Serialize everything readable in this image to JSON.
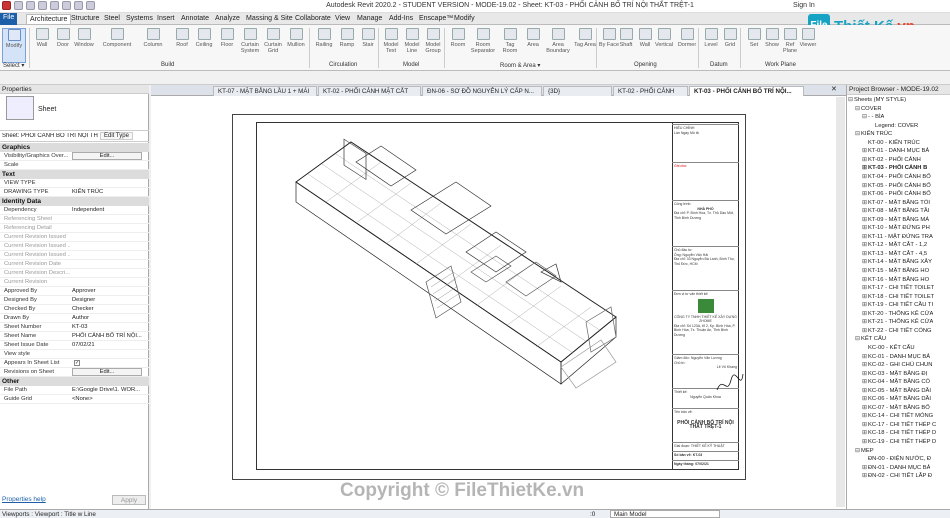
{
  "app": {
    "title": "Autodesk Revit 2020.2 - STUDENT VERSION - MODE-19.02 - Sheet: KT-03 - PHỐI CẢNH BỐ TRÍ NỘI THẤT TRỆT-1",
    "sign_in": "Sign In"
  },
  "logo": {
    "icon": "File",
    "main": "Thiết Kế",
    "dot": ".vn"
  },
  "ribbon_tabs": [
    "File",
    "Architecture",
    "Structure",
    "Steel",
    "Systems",
    "Insert",
    "Annotate",
    "Analyze",
    "Massing & Site",
    "Collaborate",
    "View",
    "Manage",
    "Add-Ins",
    "Enscape™",
    "Modify"
  ],
  "ribbon_tools": [
    "Modify",
    "Wall",
    "Door",
    "Window",
    "Component",
    "Column",
    "Roof",
    "Ceiling",
    "Floor",
    "Curtain System",
    "Curtain Grid",
    "Mullion",
    "Railing",
    "Ramp",
    "Stair",
    "Model Text",
    "Model Line",
    "Model Group",
    "Room",
    "Room Separator",
    "Tag Room",
    "Area",
    "Area Boundary",
    "Tag Area",
    "By Face",
    "Shaft",
    "Wall",
    "Vertical",
    "Dormer",
    "Level",
    "Grid",
    "Set",
    "Show",
    "Ref Plane",
    "Viewer"
  ],
  "ribbon_groups": {
    "select": "Select ▾",
    "build": "Build",
    "circulation": "Circulation",
    "model": "Model",
    "room_area": "Room & Area ▾",
    "opening": "Opening",
    "datum": "Datum",
    "work_plane": "Work Plane"
  },
  "properties": {
    "header": "Properties",
    "type_name": "Sheet",
    "selector": "Sheet: PHỐI CẢNH BỐ TRÍ NỘI THẤT",
    "edit_type": "Edit Type",
    "categories": {
      "graphics": "Graphics",
      "text": "Text",
      "identity": "Identity Data",
      "other": "Other"
    },
    "graphics": [
      {
        "k": "Visibility/Graphics Over...",
        "v": "Edit..."
      },
      {
        "k": "Scale",
        "v": ""
      }
    ],
    "text": [
      {
        "k": "VIEW TYPE",
        "v": ""
      },
      {
        "k": "DRAWING TYPE",
        "v": "KIẾN TRÚC"
      }
    ],
    "identity": [
      {
        "k": "Dependency",
        "v": "Independent"
      },
      {
        "k": "Referencing Sheet",
        "v": ""
      },
      {
        "k": "Referencing Detail",
        "v": ""
      },
      {
        "k": "Current Revision Issued",
        "v": ""
      },
      {
        "k": "Current Revision Issued ...",
        "v": ""
      },
      {
        "k": "Current Revision Issued ...",
        "v": ""
      },
      {
        "k": "Current Revision Date",
        "v": ""
      },
      {
        "k": "Current Revision Descri...",
        "v": ""
      },
      {
        "k": "Current Revision",
        "v": ""
      },
      {
        "k": "Approved By",
        "v": "Approver"
      },
      {
        "k": "Designed By",
        "v": "Designer"
      },
      {
        "k": "Checked By",
        "v": "Checker"
      },
      {
        "k": "Drawn By",
        "v": "Author"
      },
      {
        "k": "Sheet Number",
        "v": "KT-03"
      },
      {
        "k": "Sheet Name",
        "v": "PHỐI CẢNH BỐ TRÍ NỘI..."
      },
      {
        "k": "Sheet Issue Date",
        "v": "07/02/21"
      },
      {
        "k": "View style",
        "v": ""
      },
      {
        "k": "Appears In Sheet List",
        "v": ""
      },
      {
        "k": "Revisions on Sheet",
        "v": "Edit..."
      }
    ],
    "other": [
      {
        "k": "File Path",
        "v": "E:\\Google Drive\\1. WOR..."
      },
      {
        "k": "Guide Grid",
        "v": "<None>"
      }
    ],
    "help": "Properties help",
    "apply": "Apply"
  },
  "view_tabs": [
    "KT-07 - MẶT BẰNG LẦU 1 + MÁI",
    "KT-02 - PHỐI CẢNH MẶT CẮT",
    "ĐN-06 - SƠ ĐỒ NGUYÊN LÝ CẤP N...",
    "{3D}",
    "KT-02 - PHỐI CẢNH",
    "KT-03 - PHỐI CẢNH BỐ TRÍ NỘI..."
  ],
  "title_block": {
    "rev_header": "HIỆU CHỈNH",
    "rev_cols": [
      "Lần",
      "Ngày",
      "Mô tả"
    ],
    "note": "Ghi chú:",
    "owner_label": "Công trình:",
    "owner": "NHÀ PHỐ",
    "addr": "Địa chỉ: P. Bình Hòa, Tx. Thủ Dầu Một, Tỉnh Bình Dương",
    "client_label": "Chủ đầu tư:",
    "client": "Ông: Nguyễn Văn Hải",
    "client_addr": "Địa chỉ: 33 Nguyễn Bá Lanh, Bình Thọ, Thủ Đức, HCM",
    "design_unit": "Đơn vị tư vấn thiết kế:",
    "company": "CÔNG TY TNHH THIẾT KẾ XÂY DỰNG ZHOME",
    "company_addr": "Địa chỉ: Số 123A, tổ 2, Kp. Bình Hòa, P. Bình Hòa, Tx. Thuận An, Tỉnh Bình Dương",
    "director": "Giám đốc: Nguyễn Văn Lương",
    "chief": "Chủ trì:",
    "chief_name": "Lê Vũ Khang",
    "drawn": "Thiết kế:",
    "drawn_name": "Nguyễn Quân Khoa",
    "title_label": "Tên bản vẽ:",
    "title": "PHỐI CẢNH BỐ TRÍ NỘI THẤT TRỆT-1",
    "phase_label": "Giai đoạn:",
    "phase": "THIẾT KẾ KỸ THUẬT",
    "no_label": "Số bản vẽ:",
    "no": "KT-03",
    "date_label": "Ngày tháng:",
    "date": "07/02/21"
  },
  "watermark": "Copyright © FileThietKe.vn",
  "browser": {
    "header": "Project Browser - MODE-19.02",
    "items": [
      {
        "t": "Sheets (MY STYLE)",
        "l": 0,
        "g": "⊟"
      },
      {
        "t": "COVER",
        "l": 1,
        "g": "⊟"
      },
      {
        "t": "- - BÌA",
        "l": 2,
        "g": "⊟"
      },
      {
        "t": "Legend: COVER",
        "l": 3,
        "g": ""
      },
      {
        "t": "KIẾN TRÚC",
        "l": 1,
        "g": "⊟"
      },
      {
        "t": "KT-00 - KIẾN TRÚC",
        "l": 2,
        "g": ""
      },
      {
        "t": "KT-01 - DANH MỤC BẢ",
        "l": 2,
        "g": "⊞"
      },
      {
        "t": "KT-02 - PHỐI CẢNH",
        "l": 2,
        "g": "⊞"
      },
      {
        "t": "KT-03 - PHỐI CẢNH B",
        "l": 2,
        "g": "⊞",
        "b": true
      },
      {
        "t": "KT-04 - PHỐI CẢNH BỐ",
        "l": 2,
        "g": "⊞"
      },
      {
        "t": "KT-05 - PHỐI CẢNH BỐ",
        "l": 2,
        "g": "⊞"
      },
      {
        "t": "KT-06 - PHỐI CẢNH BỐ",
        "l": 2,
        "g": "⊞"
      },
      {
        "t": "KT-07 - MẶT BẰNG TỔI",
        "l": 2,
        "g": "⊞"
      },
      {
        "t": "KT-08 - MẶT BẰNG TẦI",
        "l": 2,
        "g": "⊞"
      },
      {
        "t": "KT-09 - MẶT BẰNG MÁ",
        "l": 2,
        "g": "⊞"
      },
      {
        "t": "KT-10 - MẶT ĐỨNG PH",
        "l": 2,
        "g": "⊞"
      },
      {
        "t": "KT-11 - MẶT ĐỨNG TRA",
        "l": 2,
        "g": "⊞"
      },
      {
        "t": "KT-12 - MẶT CẮT - 1,2",
        "l": 2,
        "g": "⊞"
      },
      {
        "t": "KT-13 - MẶT CẮT - 4,5",
        "l": 2,
        "g": "⊞"
      },
      {
        "t": "KT-14 - MẶT BẰNG XÂY",
        "l": 2,
        "g": "⊞"
      },
      {
        "t": "KT-15 - MẶT BẰNG HO",
        "l": 2,
        "g": "⊞"
      },
      {
        "t": "KT-16 - MẶT BẰNG HO",
        "l": 2,
        "g": "⊞"
      },
      {
        "t": "KT-17 - CHI TIẾT TOILET",
        "l": 2,
        "g": "⊞"
      },
      {
        "t": "KT-18 - CHI TIẾT TOILET",
        "l": 2,
        "g": "⊞"
      },
      {
        "t": "KT-19 - CHI TIẾT CẦU TI",
        "l": 2,
        "g": "⊞"
      },
      {
        "t": "KT-20 - THỐNG KÊ CỬA",
        "l": 2,
        "g": "⊞"
      },
      {
        "t": "KT-21 - THỐNG KÊ CỬA",
        "l": 2,
        "g": "⊞"
      },
      {
        "t": "KT-22 - CHI TIẾT CỔNG",
        "l": 2,
        "g": "⊞"
      },
      {
        "t": "KẾT CẤU",
        "l": 1,
        "g": "⊟"
      },
      {
        "t": "KC-00 - KẾT CẤU",
        "l": 2,
        "g": ""
      },
      {
        "t": "KC-01 - DANH MỤC BẢ",
        "l": 2,
        "g": "⊞"
      },
      {
        "t": "KC-02 - GHI CHÚ CHUN",
        "l": 2,
        "g": "⊞"
      },
      {
        "t": "KC-03 - MẶT BẰNG ĐỊ",
        "l": 2,
        "g": "⊞"
      },
      {
        "t": "KC-04 - MẶT BẰNG CÓ",
        "l": 2,
        "g": "⊞"
      },
      {
        "t": "KC-05 - MẶT BẰNG DẦI",
        "l": 2,
        "g": "⊞"
      },
      {
        "t": "KC-06 - MẶT BẰNG DẦI",
        "l": 2,
        "g": "⊞"
      },
      {
        "t": "KC-07 - MẶT BẰNG BỐ",
        "l": 2,
        "g": "⊞"
      },
      {
        "t": "KC-14 - CHI TIẾT MÓNG",
        "l": 2,
        "g": "⊞"
      },
      {
        "t": "KC-17 - CHI TIẾT THÉP C",
        "l": 2,
        "g": "⊞"
      },
      {
        "t": "KC-18 - CHI TIẾT THÉP D",
        "l": 2,
        "g": "⊞"
      },
      {
        "t": "KC-19 - CHI TIẾT THÉP D",
        "l": 2,
        "g": "⊞"
      },
      {
        "t": "MEP",
        "l": 1,
        "g": "⊟"
      },
      {
        "t": "ĐN-00 - ĐIỆN NƯỚC, Đ",
        "l": 2,
        "g": ""
      },
      {
        "t": "ĐN-01 - DANH MỤC BẢ",
        "l": 2,
        "g": "⊞"
      },
      {
        "t": "ĐN-02 - CHI TIẾT LẮP Đ",
        "l": 2,
        "g": "⊞"
      }
    ]
  },
  "status": {
    "left": "Viewports : Viewport : Title w Line",
    "scale": ":0",
    "model": "Main Model"
  }
}
